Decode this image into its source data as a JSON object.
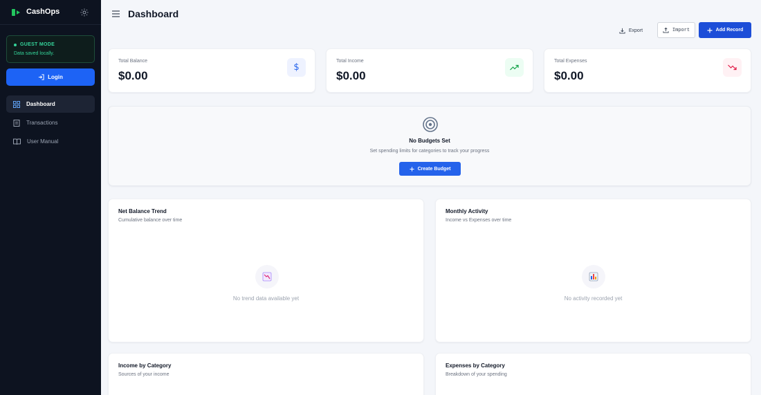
{
  "app": {
    "name": "CashOps"
  },
  "sidebar": {
    "guest": {
      "title": "GUEST MODE",
      "subtitle": "Data saved locally."
    },
    "login_label": "Login",
    "items": [
      {
        "label": "Dashboard",
        "icon": "dashboard-icon",
        "active": true
      },
      {
        "label": "Transactions",
        "icon": "receipt-icon",
        "active": false
      },
      {
        "label": "User Manual",
        "icon": "book-icon",
        "active": false
      }
    ]
  },
  "header": {
    "title": "Dashboard",
    "export_label": "Export",
    "import_label": "Import",
    "add_label": "Add Record"
  },
  "stats": [
    {
      "label": "Total Balance",
      "value": "$0.00",
      "icon": "dollar-icon",
      "color": "#2563eb"
    },
    {
      "label": "Total Income",
      "value": "$0.00",
      "icon": "trend-up-icon",
      "color": "#16a34a"
    },
    {
      "label": "Total Expenses",
      "value": "$0.00",
      "icon": "trend-down-icon",
      "color": "#e11d48"
    }
  ],
  "budgets": {
    "title": "No Budgets Set",
    "subtitle": "Set spending limits for categories to track your progress",
    "button_label": "Create Budget"
  },
  "charts": [
    {
      "title": "Net Balance Trend",
      "subtitle": "Cumulative balance over time",
      "empty": "No trend data available yet",
      "icon": "chart-down-icon"
    },
    {
      "title": "Monthly Activity",
      "subtitle": "Income vs Expenses over time",
      "empty": "No activity recorded yet",
      "icon": "bar-chart-icon"
    },
    {
      "title": "Income by Category",
      "subtitle": "Sources of your income"
    },
    {
      "title": "Expenses by Category",
      "subtitle": "Breakdown of your spending"
    }
  ],
  "colors": {
    "sidebar_bg": "#0d1320",
    "accent": "#1d4ed8",
    "guest_green": "#34d399"
  }
}
